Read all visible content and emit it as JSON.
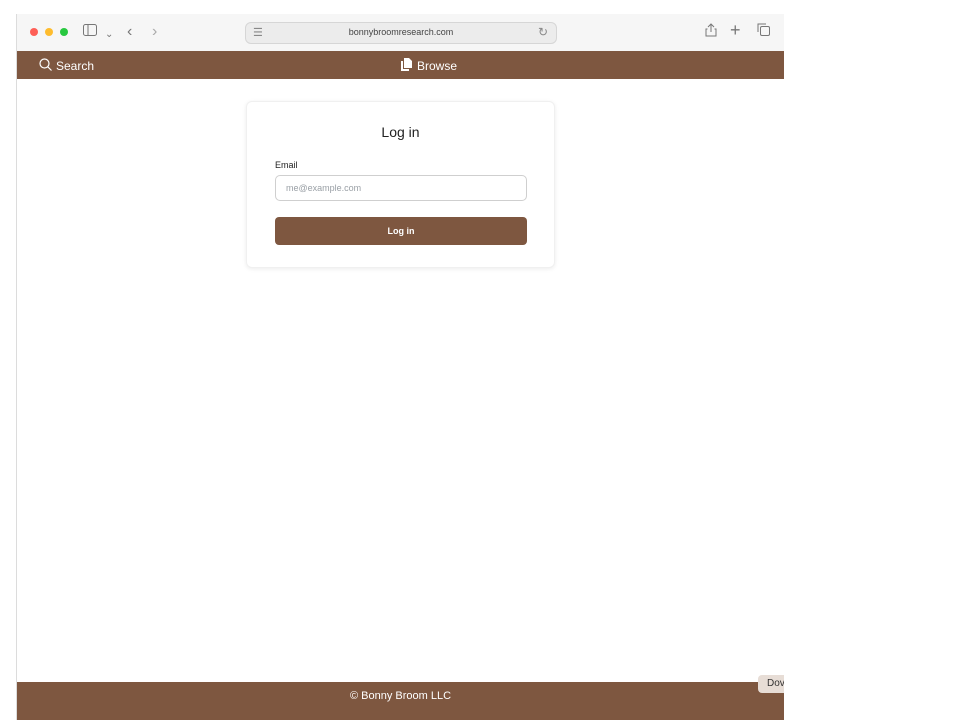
{
  "browser": {
    "url": "bonnybroomresearch.com"
  },
  "navbar": {
    "search_label": "Search",
    "browse_label": "Browse"
  },
  "login_card": {
    "title": "Log in",
    "email_label": "Email",
    "email_placeholder": "me@example.com",
    "email_value": "",
    "button_label": "Log in"
  },
  "footer": {
    "text": "© Bonny Broom LLC"
  },
  "side_tab": {
    "label": "Dov"
  },
  "colors": {
    "brand": "#7e5740",
    "background": "#ffffff"
  }
}
